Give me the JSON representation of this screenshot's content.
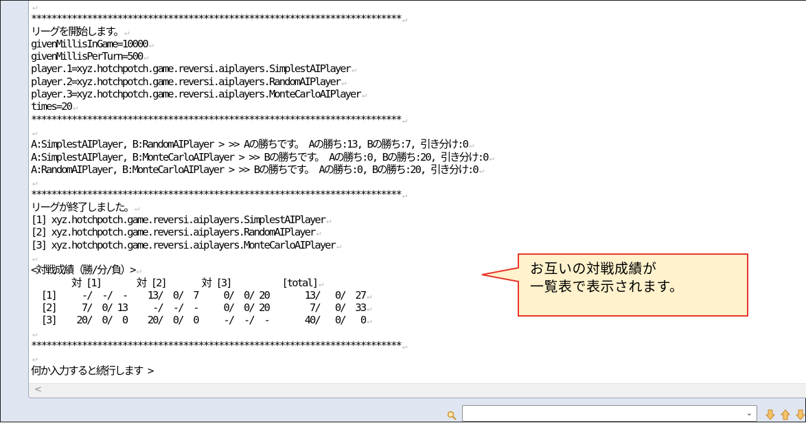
{
  "console": {
    "lines": [
      {
        "text": "",
        "ret": true
      },
      {
        "text": "*************************************************************************",
        "ret": true
      },
      {
        "text": "リーグを開始します。",
        "ret": true
      },
      {
        "text": "givenMillisInGame=10000",
        "ret": true
      },
      {
        "text": "givenMillisPerTurn=500",
        "ret": true
      },
      {
        "text": "player.1=xyz.hotchpotch.game.reversi.aiplayers.SimplestAIPlayer",
        "ret": true
      },
      {
        "text": "player.2=xyz.hotchpotch.game.reversi.aiplayers.RandomAIPlayer",
        "ret": true
      },
      {
        "text": "player.3=xyz.hotchpotch.game.reversi.aiplayers.MonteCarloAIPlayer",
        "ret": true
      },
      {
        "text": "times=20",
        "ret": true
      },
      {
        "text": "*************************************************************************",
        "ret": true
      },
      {
        "text": "",
        "ret": true
      },
      {
        "text": "A:SimplestAIPlayer, B:RandomAIPlayer > >> Aの勝ちです。 Aの勝ち:13, Bの勝ち:7, 引き分け:0",
        "ret": true
      },
      {
        "text": "A:SimplestAIPlayer, B:MonteCarloAIPlayer > >> Bの勝ちです。 Aの勝ち:0, Bの勝ち:20, 引き分け:0",
        "ret": true
      },
      {
        "text": "A:RandomAIPlayer, B:MonteCarloAIPlayer > >> Bの勝ちです。 Aの勝ち:0, Bの勝ち:20, 引き分け:0",
        "ret": true
      },
      {
        "text": "",
        "ret": true
      },
      {
        "text": "*************************************************************************",
        "ret": true
      },
      {
        "text": "リーグが終了しました。",
        "ret": true
      },
      {
        "text": "[1] xyz.hotchpotch.game.reversi.aiplayers.SimplestAIPlayer",
        "ret": true
      },
      {
        "text": "[2] xyz.hotchpotch.game.reversi.aiplayers.RandomAIPlayer",
        "ret": true
      },
      {
        "text": "[3] xyz.hotchpotch.game.reversi.aiplayers.MonteCarloAIPlayer",
        "ret": true
      },
      {
        "text": "",
        "ret": true
      },
      {
        "text": "<対戦成績（勝/分/負）>",
        "ret": true
      },
      {
        "text": "        対 [1]       対 [2]       対 [3]          [total]",
        "ret": true
      },
      {
        "text": "  [1]     -/  -/  -    13/  0/  7     0/  0/ 20       13/   0/  27",
        "ret": true
      },
      {
        "text": "  [2]     7/  0/ 13     -/  -/  -     0/  0/ 20        7/   0/  33",
        "ret": true
      },
      {
        "text": "  [3]    20/  0/  0    20/  0/  0     -/  -/  -       40/   0/   0",
        "ret": true
      },
      {
        "text": "",
        "ret": true
      },
      {
        "text": "*************************************************************************",
        "ret": true
      },
      {
        "text": "",
        "ret": true
      },
      {
        "text": "何か入力すると続行します >",
        "ret": false
      }
    ]
  },
  "callout": {
    "line1": "お互いの対戦成績が",
    "line2": "一覧表で表示されます。"
  },
  "scrollbar": {
    "left_arrow": "<"
  },
  "search": {
    "value": ""
  },
  "icons": {
    "return_mark": "↵",
    "search": "magnifier-icon",
    "next_match": "arrow-down-icon",
    "prev_match": "arrow-up-icon",
    "more": "arrow-down-more-icon"
  },
  "colors": {
    "callout_fill": "#FFF2CC",
    "callout_border": "#E8352A",
    "pane_border": "#9AA7BD",
    "toolbar_bg": "#DFE6F1",
    "arrow_icons": "#E8A43C"
  }
}
